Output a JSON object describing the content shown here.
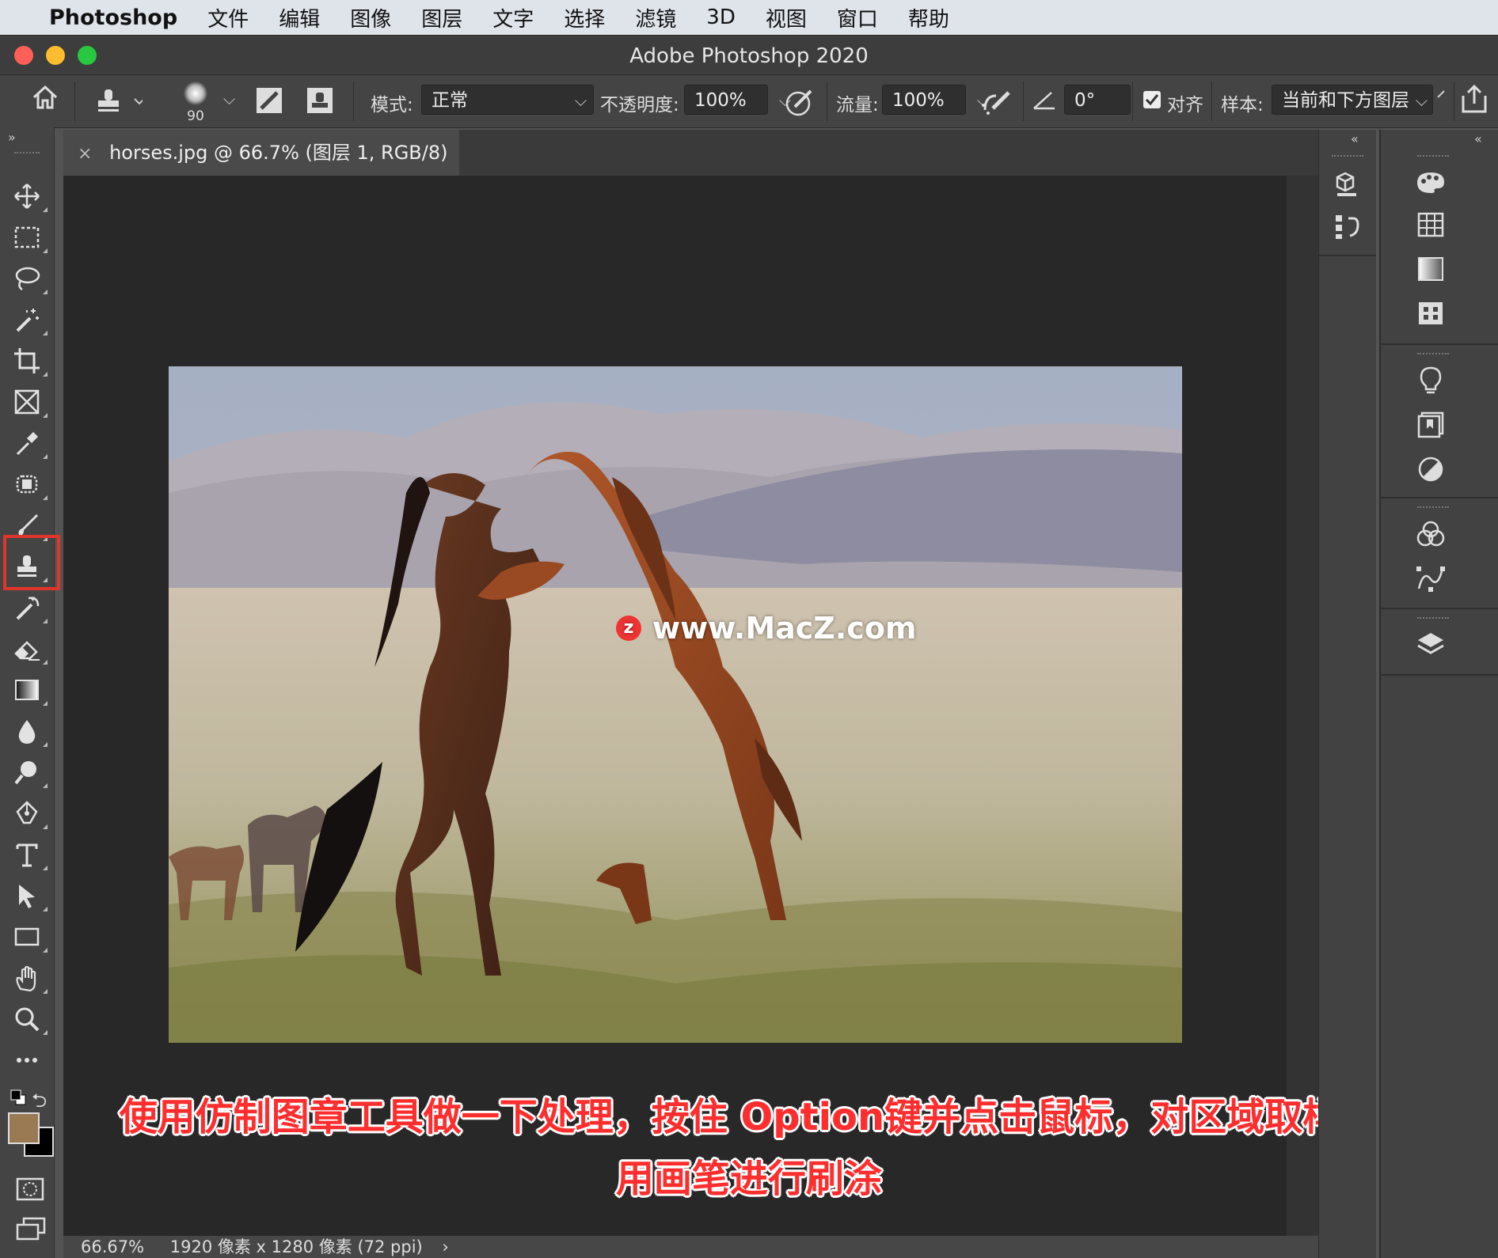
{
  "menubar": {
    "app": "Photoshop",
    "items": [
      "文件",
      "编辑",
      "图像",
      "图层",
      "文字",
      "选择",
      "滤镜",
      "3D",
      "视图",
      "窗口",
      "帮助"
    ]
  },
  "window": {
    "title": "Adobe Photoshop 2020"
  },
  "options": {
    "brush_size": "90",
    "mode_label": "模式:",
    "mode_value": "正常",
    "opacity_label": "不透明度:",
    "opacity_value": "100%",
    "flow_label": "流量:",
    "flow_value": "100%",
    "angle_value": "0°",
    "align_label": "对齐",
    "align_checked": true,
    "sample_label": "样本:",
    "sample_value": "当前和下方图层"
  },
  "document": {
    "tab_title": "horses.jpg @ 66.7% (图层 1, RGB/8) *",
    "zoom": "66.67%",
    "info": "1920 像素 x 1280 像素 (72 ppi)"
  },
  "watermark": "www.MacZ.com",
  "caption": {
    "line1": "使用仿制图章工具做一下处理，按住 Option键并点击鼠标，对区域取样，",
    "line2": "用画笔进行刷涂"
  },
  "colors": {
    "foreground": "#9a7a52",
    "background": "#000000",
    "highlight": "#e0352b"
  },
  "tools": [
    "move-tool",
    "marquee-tool",
    "lasso-tool",
    "magic-wand-tool",
    "crop-tool",
    "frame-tool",
    "eyedropper-tool",
    "healing-brush-tool",
    "brush-tool",
    "clone-stamp-tool",
    "history-brush-tool",
    "eraser-tool",
    "gradient-tool",
    "blur-tool",
    "dodge-tool",
    "pen-tool",
    "type-tool",
    "path-selection-tool",
    "rectangle-tool",
    "hand-tool",
    "zoom-tool",
    "more-tools"
  ],
  "selected_tool": "clone-stamp-tool"
}
